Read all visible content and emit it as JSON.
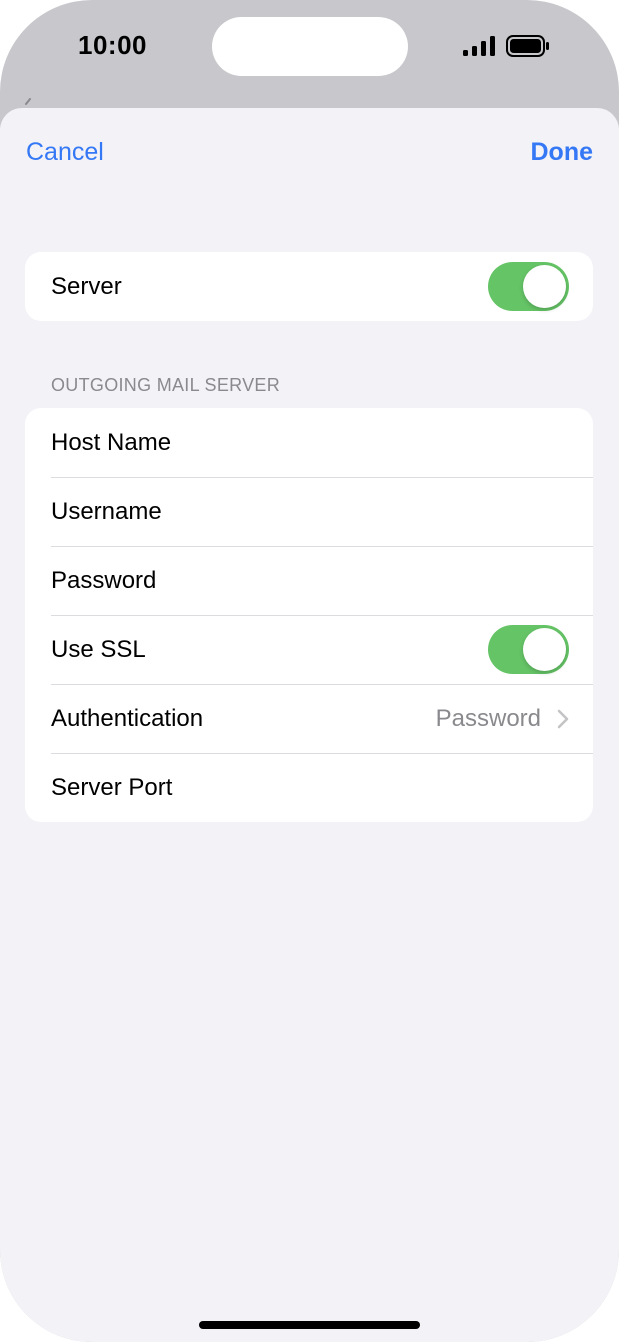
{
  "status_bar": {
    "time": "10:00",
    "signal_icon": "cellular-signal-icon",
    "battery_icon": "battery-icon"
  },
  "nav": {
    "cancel_label": "Cancel",
    "done_label": "Done"
  },
  "server_group": {
    "label": "Server",
    "toggle_on": true
  },
  "outgoing": {
    "header": "OUTGOING MAIL SERVER",
    "rows": [
      {
        "label": "Host Name"
      },
      {
        "label": "Username"
      },
      {
        "label": "Password"
      },
      {
        "label": "Use SSL",
        "toggle_on": true
      },
      {
        "label": "Authentication",
        "value": "Password",
        "icon": "chevron-right-icon"
      },
      {
        "label": "Server Port"
      }
    ]
  },
  "colors": {
    "accent": "#3478f6",
    "toggle_on": "#65c466",
    "background": "#f2f2f7",
    "secondary_text": "#8a8a8e"
  }
}
